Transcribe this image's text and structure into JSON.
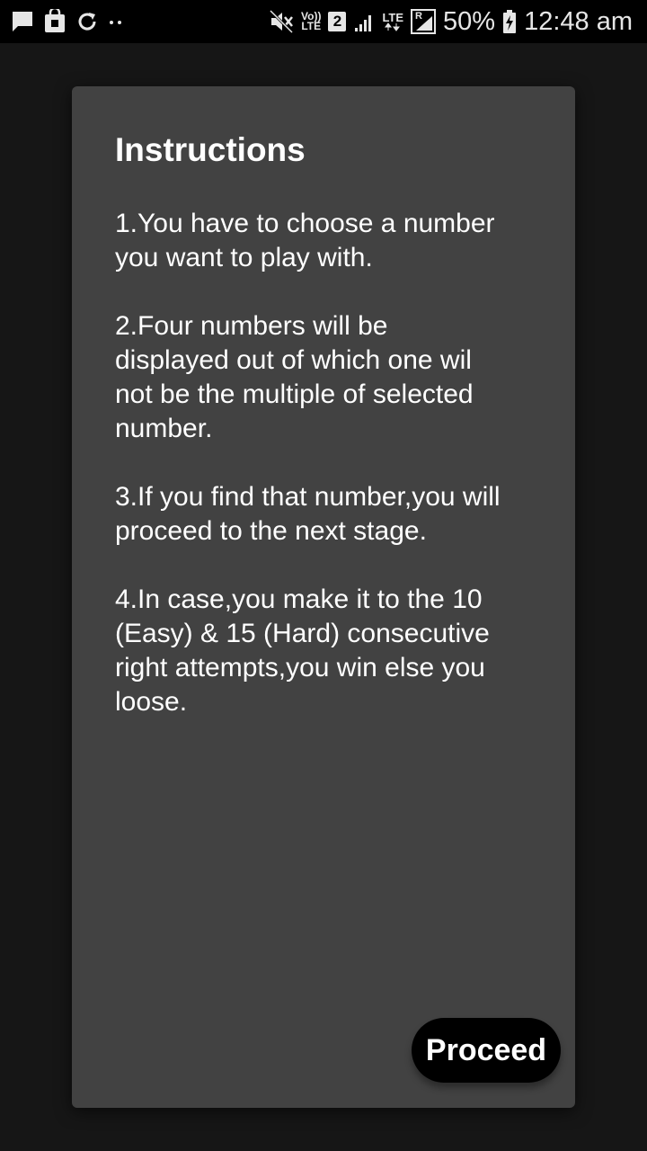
{
  "status_bar": {
    "left_icons": [
      "message-icon",
      "shopping-bag-icon",
      "sync-icon",
      "more-dots-icon"
    ],
    "volte_label_top": "Vo))",
    "volte_label_bottom": "LTE",
    "sim_slot": "2",
    "lte_label": "LTE",
    "roaming_label": "R",
    "battery_percent": "50%",
    "time": "12:48 am"
  },
  "dialog": {
    "title": "Instructions",
    "instructions": [
      "1.You have to choose a number\nyou want to play with.",
      "2.Four numbers will be\ndisplayed out of which one wil\nnot be the multiple of selected\nnumber.",
      "3.If you find that number,you will\nproceed to the next stage.",
      "4.In case,you make it to the 10\n(Easy) & 15 (Hard) consecutive\nright attempts,you win else you\nloose."
    ],
    "proceed_label": "Proceed"
  },
  "colors": {
    "background": "#161616",
    "status_bar": "#000000",
    "dialog": "#424242",
    "button": "#000000",
    "text": "#ffffff"
  }
}
